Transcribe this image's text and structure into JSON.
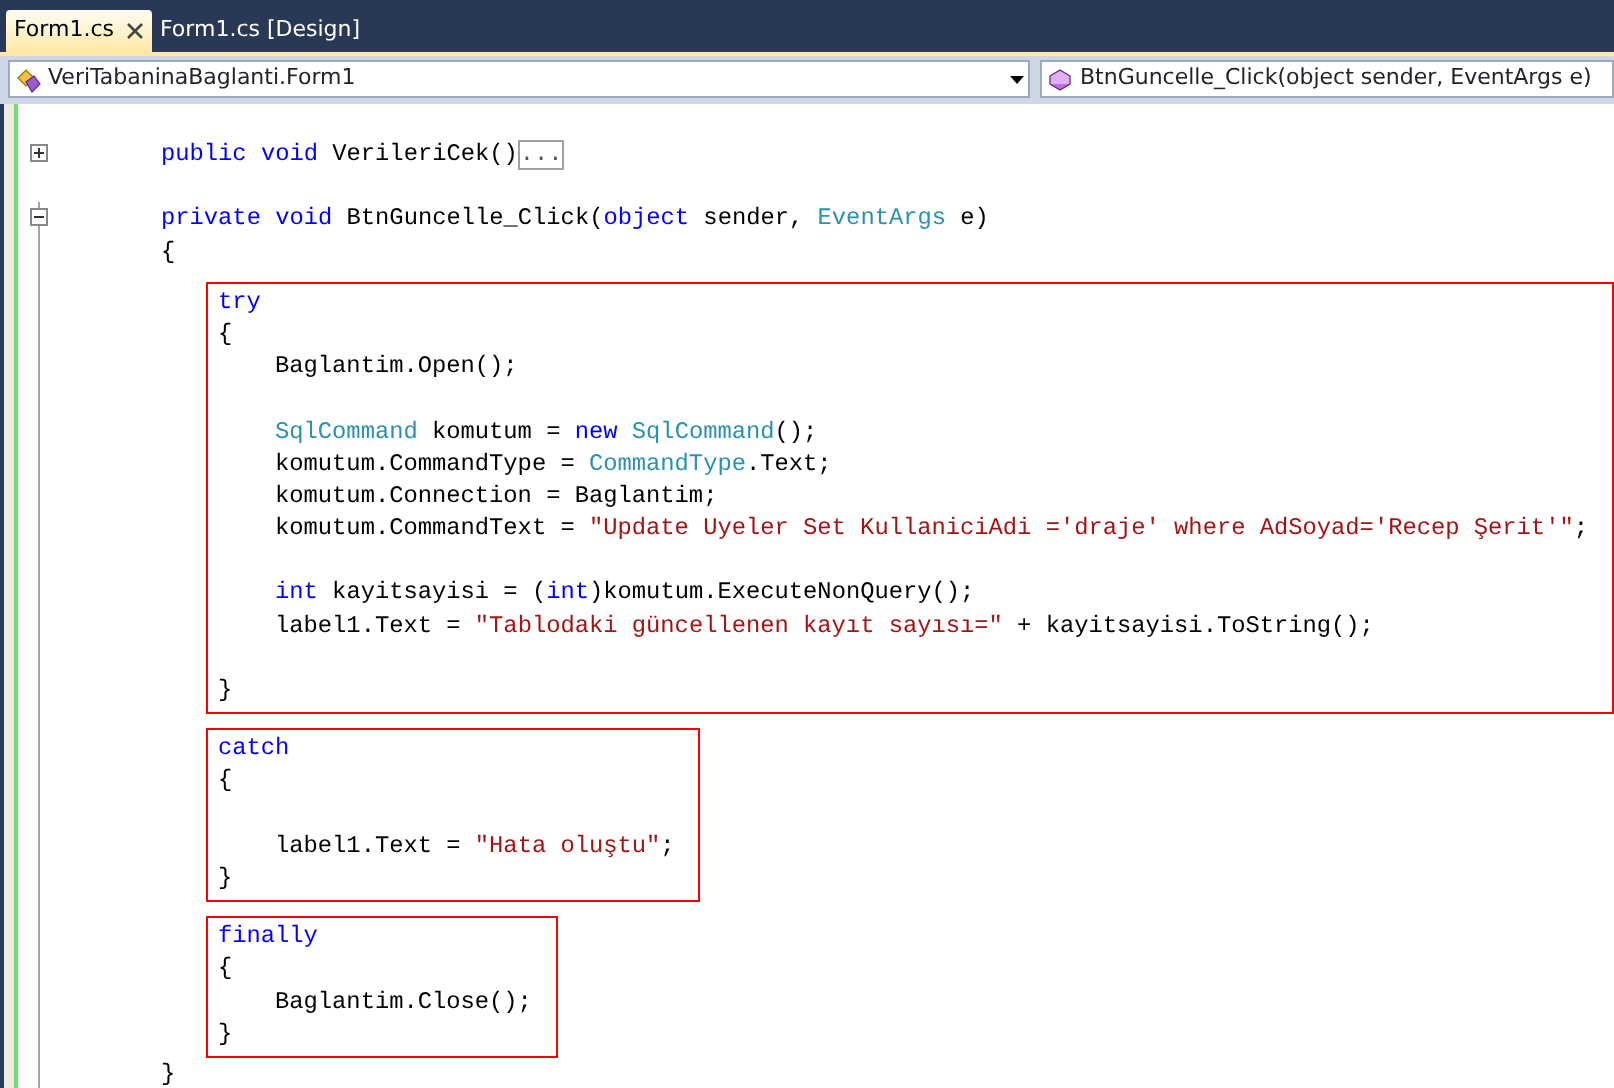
{
  "tabs": [
    {
      "label": "Form1.cs",
      "selected": true
    },
    {
      "label": "Form1.cs [Design]",
      "selected": false
    }
  ],
  "navigation_bar": {
    "type_selector": "VeriTabaninaBaglanti.Form1",
    "member_selector": "BtnGuncelle_Click(object sender, EventArgs e)"
  },
  "code": [
    {
      "kind": "line",
      "expanded": false,
      "collapsed_marker": "...",
      "indented": true,
      "tokens": [
        {
          "kind": "keyword",
          "text": "public "
        },
        {
          "kind": "keyword",
          "text": "void"
        },
        {
          "kind": "plain",
          "text": " VerileriCek()"
        }
      ]
    },
    {
      "kind": "blank"
    },
    {
      "kind": "line",
      "expanded": true,
      "indented": true,
      "tokens": [
        {
          "kind": "keyword",
          "text": "private "
        },
        {
          "kind": "keyword",
          "text": "void"
        },
        {
          "kind": "plain",
          "text": " BtnGuncelle_Click("
        },
        {
          "kind": "keyword",
          "text": "object"
        },
        {
          "kind": "plain",
          "text": " sender, "
        },
        {
          "kind": "type",
          "text": "EventArgs"
        },
        {
          "kind": "plain",
          "text": " e)"
        }
      ]
    },
    {
      "kind": "line",
      "indented": true,
      "tokens": [
        {
          "kind": "plain",
          "text": "{"
        }
      ]
    },
    {
      "kind": "box",
      "items": [
        {
          "kind": "line",
          "tokens": [
            {
              "kind": "keyword",
              "text": "try"
            }
          ]
        },
        {
          "kind": "line",
          "tokens": [
            {
              "kind": "plain",
              "text": "{"
            }
          ]
        },
        {
          "kind": "line",
          "indented": true,
          "tokens": [
            {
              "kind": "plain",
              "text": "Baglantim.Open();"
            }
          ]
        },
        {
          "kind": "blank"
        },
        {
          "kind": "line",
          "indented": true,
          "tokens": [
            {
              "kind": "type",
              "text": "SqlCommand"
            },
            {
              "kind": "plain",
              "text": " komutum = "
            },
            {
              "kind": "keyword",
              "text": "new "
            },
            {
              "kind": "type",
              "text": "SqlCommand"
            },
            {
              "kind": "plain",
              "text": "();"
            }
          ]
        },
        {
          "kind": "line",
          "indented": true,
          "tokens": [
            {
              "kind": "plain",
              "text": "komutum.CommandType = "
            },
            {
              "kind": "type",
              "text": "CommandType"
            },
            {
              "kind": "plain",
              "text": ".Text;"
            }
          ]
        },
        {
          "kind": "line",
          "indented": true,
          "tokens": [
            {
              "kind": "plain",
              "text": "komutum.Connection = Baglantim;"
            }
          ]
        },
        {
          "kind": "line",
          "indented": true,
          "tokens": [
            {
              "kind": "plain",
              "text": "komutum.CommandText = "
            },
            {
              "kind": "string",
              "text": "\"Update Uyeler Set KullaniciAdi ='draje' where AdSoyad='Recep Şerit'\""
            },
            {
              "kind": "plain",
              "text": ";"
            }
          ]
        },
        {
          "kind": "blank"
        },
        {
          "kind": "line",
          "indented": true,
          "tokens": [
            {
              "kind": "keyword",
              "text": "int"
            },
            {
              "kind": "plain",
              "text": " kayitsayisi = ("
            },
            {
              "kind": "keyword",
              "text": "int"
            },
            {
              "kind": "plain",
              "text": ")komutum.ExecuteNonQuery();"
            }
          ]
        },
        {
          "kind": "line",
          "indented": true,
          "tokens": [
            {
              "kind": "plain",
              "text": "label1.Text = "
            },
            {
              "kind": "string",
              "text": "\"Tablodaki güncellenen kayıt sayısı=\""
            },
            {
              "kind": "plain",
              "text": " + kayitsayisi.ToString();"
            }
          ]
        },
        {
          "kind": "blank"
        },
        {
          "kind": "line",
          "tokens": [
            {
              "kind": "plain",
              "text": "}"
            }
          ]
        }
      ]
    },
    {
      "kind": "box",
      "items": [
        {
          "kind": "line",
          "tokens": [
            {
              "kind": "keyword",
              "text": "catch"
            }
          ]
        },
        {
          "kind": "line",
          "tokens": [
            {
              "kind": "plain",
              "text": "{"
            }
          ]
        },
        {
          "kind": "blank"
        },
        {
          "kind": "line",
          "indented": true,
          "tokens": [
            {
              "kind": "plain",
              "text": "label1.Text = "
            },
            {
              "kind": "string",
              "text": "\"Hata oluştu\""
            },
            {
              "kind": "plain",
              "text": ";"
            }
          ]
        },
        {
          "kind": "line",
          "tokens": [
            {
              "kind": "plain",
              "text": "}"
            }
          ]
        }
      ]
    },
    {
      "kind": "box",
      "items": [
        {
          "kind": "line",
          "tokens": [
            {
              "kind": "keyword",
              "text": "finally"
            }
          ]
        },
        {
          "kind": "line",
          "tokens": [
            {
              "kind": "plain",
              "text": "{"
            }
          ]
        },
        {
          "kind": "line",
          "indented": true,
          "tokens": [
            {
              "kind": "plain",
              "text": "Baglantim.Close();"
            }
          ]
        },
        {
          "kind": "line",
          "tokens": [
            {
              "kind": "plain",
              "text": "}"
            }
          ]
        }
      ]
    },
    {
      "kind": "line",
      "indented": true,
      "tokens": [
        {
          "kind": "plain",
          "text": "}"
        }
      ]
    }
  ]
}
